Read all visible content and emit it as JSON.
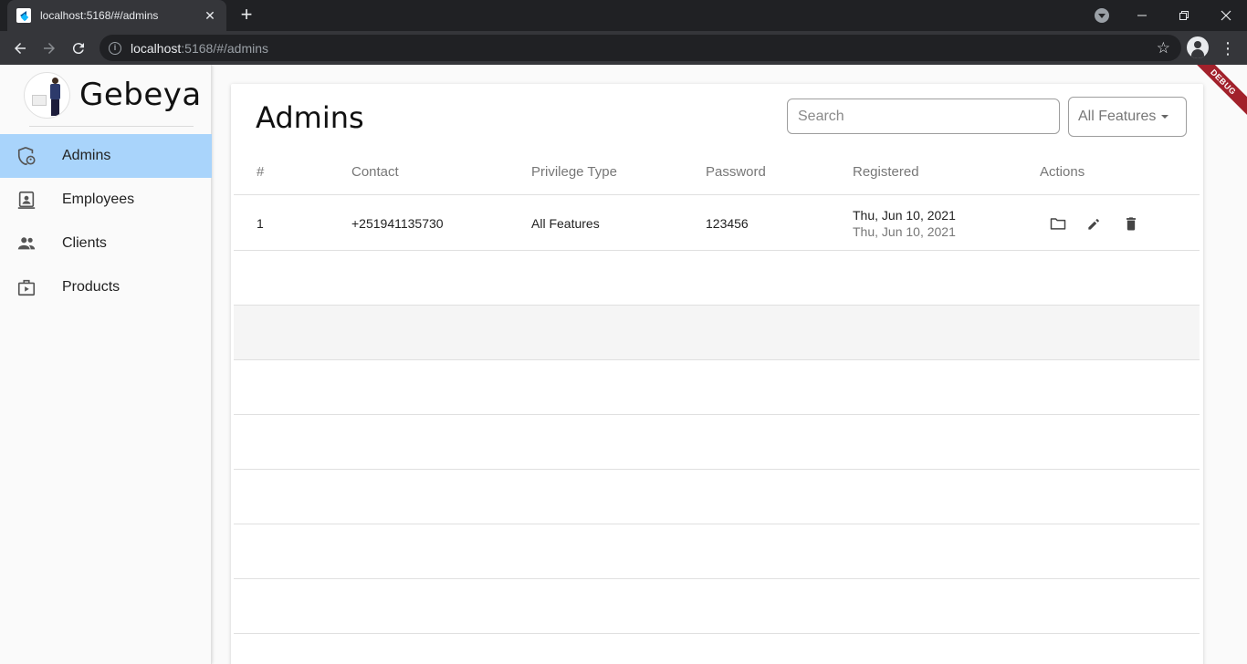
{
  "browser": {
    "tab_title": "localhost:5168/#/admins",
    "url_host": "localhost",
    "url_path": ":5168/#/admins"
  },
  "sidebar": {
    "brand": "Gebeya",
    "items": [
      {
        "label": "Admins",
        "icon": "admin-shield-icon"
      },
      {
        "label": "Employees",
        "icon": "badge-icon"
      },
      {
        "label": "Clients",
        "icon": "people-icon"
      },
      {
        "label": "Products",
        "icon": "product-box-icon"
      }
    ]
  },
  "main": {
    "title": "Admins",
    "search_placeholder": "Search",
    "filter_value": "All Features",
    "columns": [
      "#",
      "Contact",
      "Privilege Type",
      "Password",
      "Registered",
      "Actions"
    ],
    "rows": [
      {
        "index": "1",
        "contact": "+251941135730",
        "privilege": "All Features",
        "password": "123456",
        "registered_primary": "Thu, Jun 10, 2021",
        "registered_secondary": "Thu, Jun 10, 2021"
      }
    ]
  },
  "debug_banner": "DEBUG",
  "colors": {
    "active_nav": "#a9d4fb",
    "banner": "#a2212b"
  }
}
